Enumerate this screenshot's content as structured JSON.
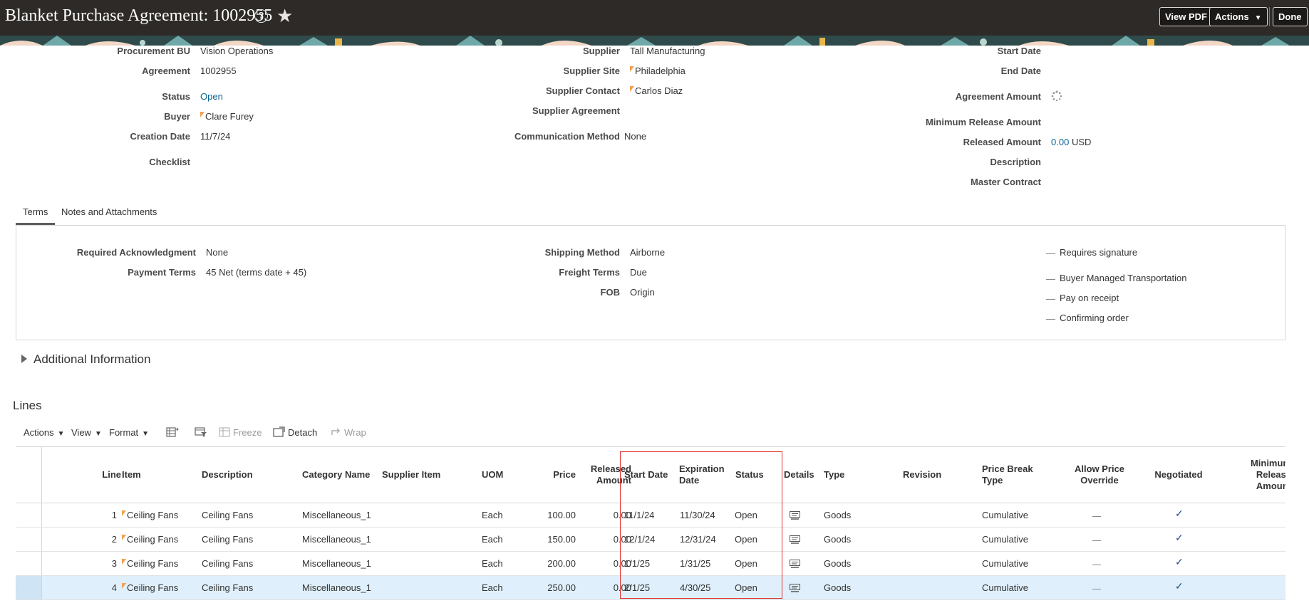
{
  "header": {
    "title": "Blanket Purchase Agreement: 1002955",
    "view_pdf_label": "View PDF",
    "actions_label": "Actions",
    "done_label": "Done"
  },
  "summary": {
    "col1": [
      {
        "label": "Procurement BU",
        "value": "Vision Operations"
      },
      {
        "label": "Agreement",
        "value": "1002955"
      },
      {
        "label": "Status",
        "value": "Open"
      },
      {
        "label": "Buyer",
        "value": "Clare Furey"
      },
      {
        "label": "Creation Date",
        "value": "11/7/24"
      },
      {
        "label": "Checklist",
        "value": ""
      }
    ],
    "col2": [
      {
        "label": "Supplier",
        "value": "Tall Manufacturing"
      },
      {
        "label": "Supplier Site",
        "value": "Philadelphia"
      },
      {
        "label": "Supplier Contact",
        "value": "Carlos Diaz"
      },
      {
        "label": "Supplier Agreement",
        "value": ""
      },
      {
        "label": "Communication Method",
        "value": "None"
      }
    ],
    "col3": [
      {
        "label": "Start Date",
        "value": ""
      },
      {
        "label": "End Date",
        "value": ""
      },
      {
        "label": "Agreement Amount",
        "value": ""
      },
      {
        "label": "Minimum Release Amount",
        "value": ""
      },
      {
        "label": "Released Amount",
        "value": "0.00",
        "unit": "USD"
      },
      {
        "label": "Description",
        "value": ""
      },
      {
        "label": "Master Contract",
        "value": ""
      }
    ]
  },
  "tabs": [
    "Terms",
    "Notes and Attachments"
  ],
  "terms": {
    "left": [
      {
        "label": "Required Acknowledgment",
        "value": "None"
      },
      {
        "label": "Payment Terms",
        "value": "45 Net (terms date + 45)"
      }
    ],
    "middle": [
      {
        "label": "Shipping Method",
        "value": "Airborne"
      },
      {
        "label": "Freight Terms",
        "value": "Due"
      },
      {
        "label": "FOB",
        "value": "Origin"
      }
    ],
    "flags": [
      "Requires signature",
      "Buyer Managed Transportation",
      "Pay on receipt",
      "Confirming order"
    ]
  },
  "additional_info_title": "Additional Information",
  "lines": {
    "title": "Lines",
    "toolbar": {
      "actions": "Actions",
      "view": "View",
      "format": "Format",
      "freeze": "Freeze",
      "detach": "Detach",
      "wrap": "Wrap"
    },
    "columns": {
      "line": "Line",
      "item": "Item",
      "description": "Description",
      "category": "Category Name",
      "supplier_item": "Supplier Item",
      "uom": "UOM",
      "price": "Price",
      "released_1": "Released",
      "released_2": "Amount",
      "start_date": "Start Date",
      "exp_1": "Expiration",
      "exp_2": "Date",
      "status": "Status",
      "details": "Details",
      "type": "Type",
      "revision": "Revision",
      "pb_1": "Price Break",
      "pb_2": "Type",
      "apo_1": "Allow Price",
      "apo_2": "Override",
      "negotiated": "Negotiated",
      "min_1": "Minimum",
      "min_2": "Release",
      "min_3": "Amount"
    },
    "rows": [
      {
        "line": "1",
        "item": "Ceiling Fans",
        "description": "Ceiling Fans",
        "category": "Miscellaneous_1",
        "uom": "Each",
        "price": "100.00",
        "released": "0.00",
        "start": "11/1/24",
        "expiration": "11/30/24",
        "status": "Open",
        "type": "Goods",
        "price_break": "Cumulative"
      },
      {
        "line": "2",
        "item": "Ceiling Fans",
        "description": "Ceiling Fans",
        "category": "Miscellaneous_1",
        "uom": "Each",
        "price": "150.00",
        "released": "0.00",
        "start": "12/1/24",
        "expiration": "12/31/24",
        "status": "Open",
        "type": "Goods",
        "price_break": "Cumulative"
      },
      {
        "line": "3",
        "item": "Ceiling Fans",
        "description": "Ceiling Fans",
        "category": "Miscellaneous_1",
        "uom": "Each",
        "price": "200.00",
        "released": "0.00",
        "start": "1/1/25",
        "expiration": "1/31/25",
        "status": "Open",
        "type": "Goods",
        "price_break": "Cumulative"
      },
      {
        "line": "4",
        "item": "Ceiling Fans",
        "description": "Ceiling Fans",
        "category": "Miscellaneous_1",
        "uom": "Each",
        "price": "250.00",
        "released": "0.00",
        "start": "2/1/25",
        "expiration": "4/30/25",
        "status": "Open",
        "type": "Goods",
        "price_break": "Cumulative"
      }
    ]
  }
}
